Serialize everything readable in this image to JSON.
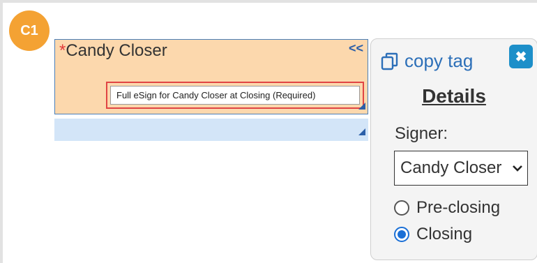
{
  "badge": {
    "label": "C1",
    "color": "#f4a233"
  },
  "tag": {
    "required_marker": "*",
    "title": "Candy Closer",
    "collapse_label": "<<",
    "tooltip": "Full eSign for Candy Closer at Closing (Required)",
    "fill_color": "#fcd8ad"
  },
  "panel": {
    "copy_label": "copy tag",
    "copy_icon": "copy-icon",
    "close_icon": "close-icon",
    "close_label": "✖",
    "details_title": "Details",
    "signer_label": "Signer:",
    "signer_value": "Candy Closer",
    "radio_options": [
      {
        "label": "Pre-closing",
        "checked": false
      },
      {
        "label": "Closing",
        "checked": true
      }
    ]
  }
}
